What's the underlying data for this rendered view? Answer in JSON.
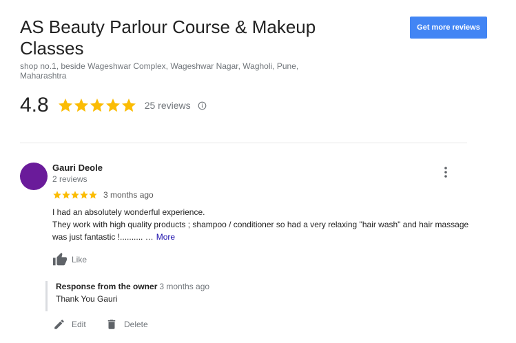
{
  "business": {
    "title": "AS Beauty Parlour Course & Makeup Classes",
    "address": "shop no.1, beside Wageshwar Complex, Wageshwar Nagar, Wagholi, Pune, Maharashtra",
    "rating": "4.8",
    "stars": 5,
    "review_count": "25 reviews",
    "info_icon": "info-icon"
  },
  "toolbar": {
    "get_more_reviews_label": "Get more reviews"
  },
  "review": {
    "author": "Gauri Deole",
    "author_meta": "2 reviews",
    "stars": 5,
    "time": "3 months ago",
    "text_line1": "I had an absolutely wonderful experience.",
    "text_line2": "They work with high quality products ; shampoo / conditioner so had a very relaxing \"hair wash\" and hair massage was just fantastic !.......... …",
    "more_label": "More",
    "like_label": "Like",
    "avatar_color": "#6a1b9a"
  },
  "owner_response": {
    "title": "Response from the owner",
    "time": "3 months ago",
    "text": "Thank You Gauri"
  },
  "actions": {
    "edit_label": "Edit",
    "delete_label": "Delete"
  },
  "colors": {
    "accent": "#4285f4",
    "star": "#fbbc04",
    "link": "#1a0dab"
  }
}
